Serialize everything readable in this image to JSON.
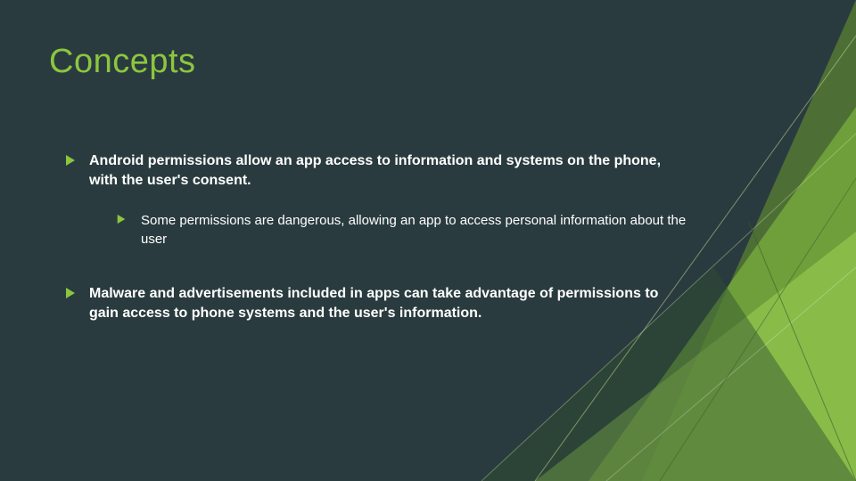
{
  "title": "Concepts",
  "bullets": [
    {
      "text": "Android permissions allow an app access to information and systems on the phone, with the user's consent.",
      "bold": true,
      "sub": [
        {
          "text": "Some permissions are dangerous, allowing an app to access personal information about the user"
        }
      ]
    },
    {
      "text": "Malware and advertisements included in apps can take advantage of permissions to gain access to phone systems and the user's information.",
      "bold": true,
      "sub": []
    }
  ],
  "colors": {
    "background": "#2a3b3f",
    "accent": "#8cc63f",
    "text": "#ffffff"
  }
}
